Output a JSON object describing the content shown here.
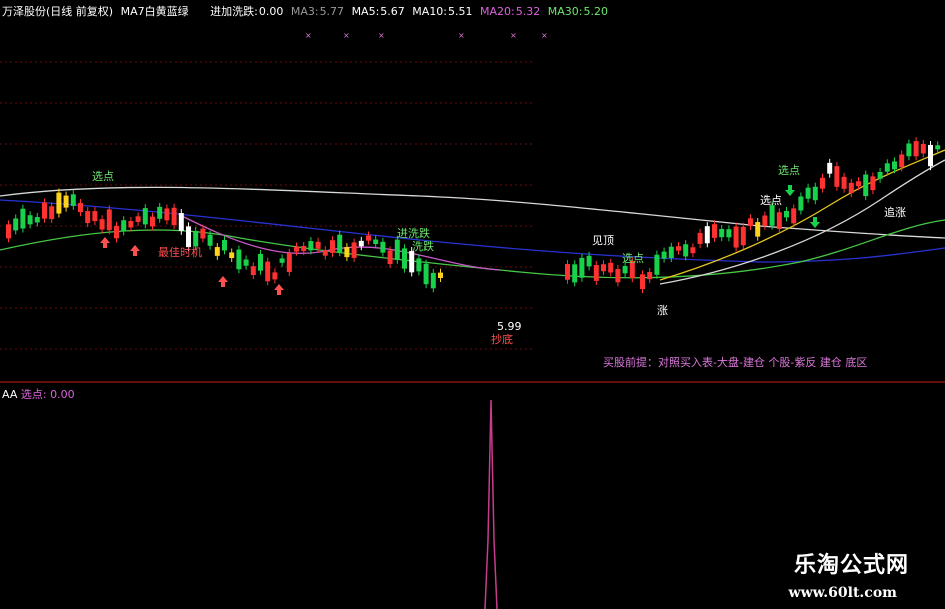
{
  "header": {
    "stock": "万泽股份(日线 前复权)",
    "ma_note": "MA7白黄蓝绿",
    "wash_label": "进加洗跌:",
    "wash_value": "0.00",
    "ma3_label": "MA3:",
    "ma3_value": "5.77",
    "ma5_label": "MA5:",
    "ma5_value": "5.67",
    "ma10_label": "MA10:",
    "ma10_value": "5.51",
    "ma20_label": "MA20:",
    "ma20_value": "5.32",
    "ma30_label": "MA30:",
    "ma30_value": "5.20"
  },
  "annotations": {
    "xuandian_top": "选点",
    "best_buy": "最佳时机",
    "wash_drop1": "进洗跌",
    "wash_drop2": "洗跌",
    "cheng_ding": "见顶",
    "xuandian_mid": "选点",
    "zhang": "涨",
    "xuandian_right1": "选点",
    "xuandian_right2": "选点",
    "zhui_zhang": "追涨",
    "low_price": "5.99",
    "low_tag": "抄底",
    "buy_premise": "买股前提：对照买入表-大盘-建仓 个股-紫反 建仓 底区"
  },
  "sub_panel": {
    "name": "AA",
    "label": "选点:",
    "value": "0.00"
  },
  "watermark": {
    "title": "乐淘公式网",
    "url": "www.60lt.com"
  },
  "colors": {
    "up": "#ff3232",
    "down": "#19d24b",
    "yellow": "#ffd21e",
    "white": "#ffffff",
    "ma_white": "#d8d8d8",
    "ma_yellow": "#e6c81e",
    "ma_blue": "#2832d2",
    "ma_green": "#46c846",
    "ma_purple": "#c85ac8",
    "grid": "#6e0a0a",
    "divider": "#c81e1e",
    "label_green": "#6ee66e",
    "label_red": "#ff5050",
    "label_purple": "#dc78dc"
  }
}
